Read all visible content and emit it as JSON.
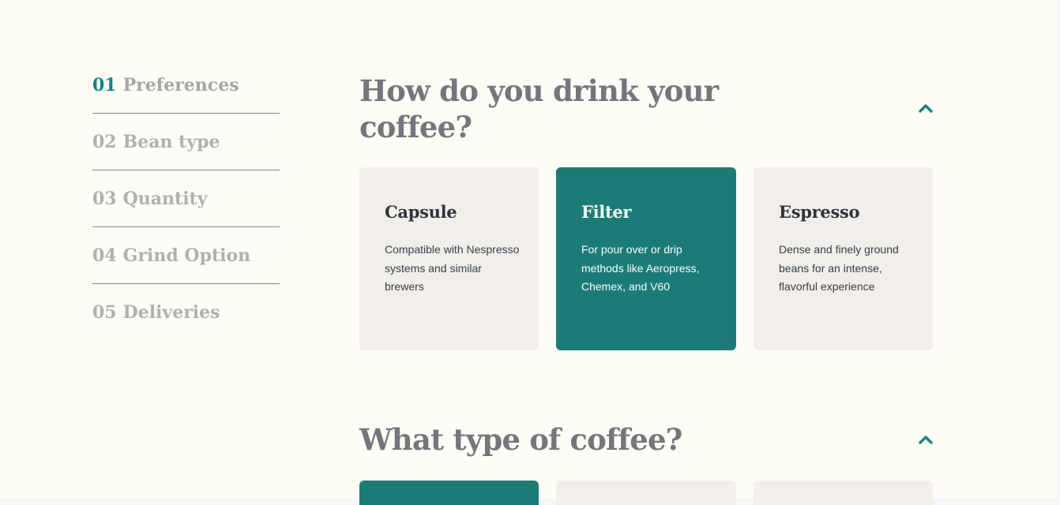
{
  "steps": [
    {
      "num": "01",
      "label": "Preferences",
      "active": true
    },
    {
      "num": "02",
      "label": "Bean type",
      "active": false
    },
    {
      "num": "03",
      "label": "Quantity",
      "active": false
    },
    {
      "num": "04",
      "label": "Grind Option",
      "active": false
    },
    {
      "num": "05",
      "label": "Deliveries",
      "active": false
    }
  ],
  "sections": [
    {
      "title": "How do you drink your coffee?",
      "toggle_icon": "chevron-up-icon",
      "options": [
        {
          "title": "Capsule",
          "desc": "Compatible with Nespresso systems and similar brewers",
          "selected": false
        },
        {
          "title": "Filter",
          "desc": "For pour over or drip methods like Aeropress, Chemex, and V60",
          "selected": true
        },
        {
          "title": "Espresso",
          "desc": "Dense and finely ground beans for an intense, flavorful experience",
          "selected": false
        }
      ]
    },
    {
      "title": "What type of coffee?",
      "toggle_icon": "chevron-up-icon",
      "options": [
        {
          "selected": true
        },
        {
          "selected": false
        },
        {
          "selected": false
        }
      ]
    }
  ],
  "colors": {
    "background": "#FEFDF5",
    "accent": "#1B7C77",
    "card": "#F2EFEA",
    "heading": "#73777D",
    "active_number": "#0E8784"
  }
}
